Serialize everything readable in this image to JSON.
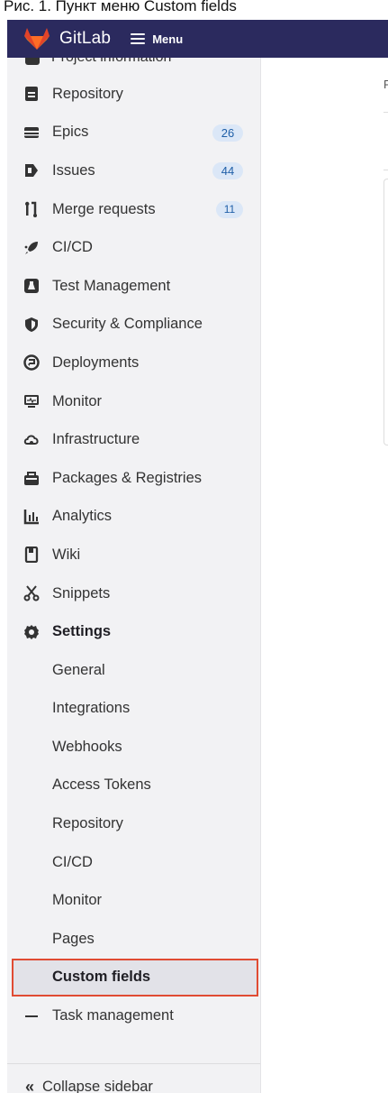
{
  "caption": "Рис. 1. Пункт меню Custom fields",
  "topbar": {
    "brand": "GitLab",
    "menu_label": "Menu"
  },
  "sidebar": {
    "cut_item": "Project information",
    "items": [
      {
        "label": "Repository",
        "icon": "repository-icon"
      },
      {
        "label": "Epics",
        "icon": "epics-icon",
        "badge": "26"
      },
      {
        "label": "Issues",
        "icon": "issues-icon",
        "badge": "44"
      },
      {
        "label": "Merge requests",
        "icon": "merge-request-icon",
        "badge": "11"
      },
      {
        "label": "CI/CD",
        "icon": "rocket-icon"
      },
      {
        "label": "Test Management",
        "icon": "test-flask-icon"
      },
      {
        "label": "Security & Compliance",
        "icon": "shield-icon"
      },
      {
        "label": "Deployments",
        "icon": "deployments-icon"
      },
      {
        "label": "Monitor",
        "icon": "monitor-icon"
      },
      {
        "label": "Infrastructure",
        "icon": "cloud-icon"
      },
      {
        "label": "Packages & Registries",
        "icon": "package-icon"
      },
      {
        "label": "Analytics",
        "icon": "analytics-icon"
      },
      {
        "label": "Wiki",
        "icon": "book-icon"
      },
      {
        "label": "Snippets",
        "icon": "scissors-icon"
      },
      {
        "label": "Settings",
        "icon": "gear-icon"
      }
    ],
    "settings_sub": [
      "General",
      "Integrations",
      "Webhooks",
      "Access Tokens",
      "Repository",
      "CI/CD",
      "Monitor",
      "Pages",
      "Custom fields"
    ],
    "task_management": "Task management",
    "collapse_label": "Collapse sidebar"
  },
  "colors": {
    "topbar": "#2b2a5e",
    "badge_bg": "#dbe7f7",
    "badge_text": "#1f5fa8",
    "highlight_border": "#e04b33"
  }
}
